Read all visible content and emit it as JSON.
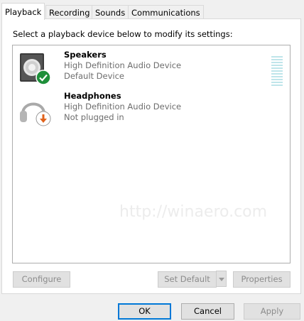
{
  "tabs": [
    {
      "label": "Playback",
      "active": true
    },
    {
      "label": "Recording",
      "active": false
    },
    {
      "label": "Sounds",
      "active": false
    },
    {
      "label": "Communications",
      "active": false
    }
  ],
  "instruction": "Select a playback device below to modify its settings:",
  "devices": [
    {
      "name": "Speakers",
      "description": "High Definition Audio Device",
      "status": "Default Device",
      "icon": "speaker-icon",
      "badge": "checkmark-badge-icon",
      "badge_color": "#1e8f3a"
    },
    {
      "name": "Headphones",
      "description": "High Definition Audio Device",
      "status": "Not plugged in",
      "icon": "headphones-icon",
      "badge": "unplugged-arrow-badge-icon",
      "badge_color": "#e0621b"
    }
  ],
  "buttons": {
    "configure": "Configure",
    "set_default": "Set Default",
    "properties": "Properties",
    "ok": "OK",
    "cancel": "Cancel",
    "apply": "Apply"
  },
  "watermark_text": "http://winaero.com"
}
